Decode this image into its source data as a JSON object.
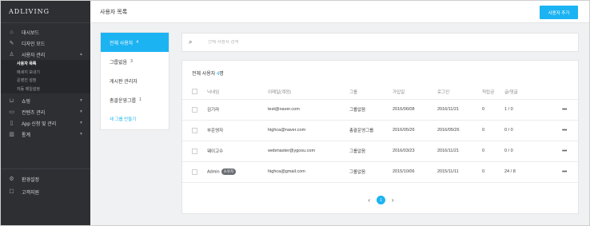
{
  "brand": "ADLIVING",
  "sidebar": {
    "items": [
      {
        "label": "대시보드",
        "icon": "home-icon"
      },
      {
        "label": "디자인 모드",
        "icon": "design-icon"
      },
      {
        "label": "사용자 관리",
        "icon": "user-icon",
        "expanded": true,
        "sub": [
          {
            "label": "사용자 목록",
            "active": true
          },
          {
            "label": "메세지 보내기"
          },
          {
            "label": "운영진 설정"
          },
          {
            "label": "자동 메일설정"
          }
        ]
      },
      {
        "label": "쇼핑",
        "icon": "cart-icon"
      },
      {
        "label": "컨텐츠 관리",
        "icon": "content-icon"
      },
      {
        "label": "App 신청 및 관리",
        "icon": "mobile-icon"
      },
      {
        "label": "통계",
        "icon": "chart-icon"
      }
    ],
    "bottom": [
      {
        "label": "환경설정",
        "icon": "gear-icon"
      },
      {
        "label": "고객지원",
        "icon": "support-icon"
      }
    ]
  },
  "header": {
    "title": "사용자 목록",
    "add_button": "사용자 추가"
  },
  "groups": [
    {
      "label": "전체 사용자",
      "count": "4",
      "active": true
    },
    {
      "label": "그룹없음",
      "count": "3"
    },
    {
      "label": "게시판 관리자",
      "count": ""
    },
    {
      "label": "총괄운영그룹",
      "count": "1"
    }
  ],
  "new_group": "새 그룹 만들기",
  "search": {
    "placeholder": "전체 사용자 검색"
  },
  "table": {
    "title": "전체 사용자",
    "total": "4",
    "unit": "명",
    "columns": [
      "닉네임",
      "이메일(계정)",
      "그룹",
      "가입일",
      "로그인",
      "적립금",
      "글/댓글"
    ],
    "rows": [
      {
        "nickname": "김기라",
        "badge": "",
        "email": "test@naver.com",
        "group": "그룹없음",
        "joined": "2016/06/08",
        "login": "2016/11/21",
        "points": "0",
        "posts": "1 / 0"
      },
      {
        "nickname": "부운영자",
        "badge": "",
        "email": "highca@naver.com",
        "group": "총괄운영그룹",
        "joined": "2016/05/26",
        "login": "2016/05/26",
        "points": "0",
        "posts": "0 / 0"
      },
      {
        "nickname": "웨이고수",
        "badge": "",
        "email": "webmaster@ygosu.com",
        "group": "그룹없음",
        "joined": "2016/03/23",
        "login": "2016/11/21",
        "points": "0",
        "posts": "0 / 0"
      },
      {
        "nickname": "Admin",
        "badge": "소유자",
        "email": "highca@gmail.com",
        "group": "그룹없음",
        "joined": "2015/10/06",
        "login": "2015/11/11",
        "points": "0",
        "posts": "24 / 8"
      }
    ]
  },
  "pagination": {
    "current": "1"
  },
  "colors": {
    "accent": "#1cb3f2",
    "sidebar_bg": "#2d2f33"
  }
}
